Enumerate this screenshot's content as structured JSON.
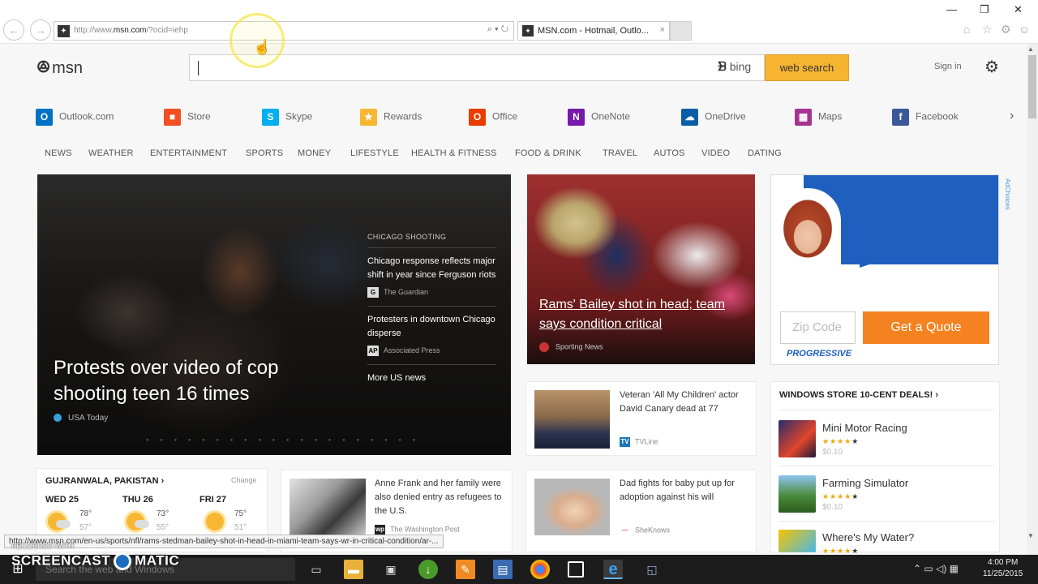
{
  "browser": {
    "url_prefix": "http://www.",
    "url_domain": "msn.com",
    "url_suffix": "/?ocid=iehp",
    "address_tools": "⌕ ▾ ↻",
    "tab_title": "MSN.com - Hotmail, Outlo...",
    "tab_close": "×",
    "back": "←",
    "forward": "→",
    "status_url": "http://www.msn.com/en-us/sports/nfl/rams-stedman-bailey-shot-in-head-in-miami-team-says-wr-in-critical-condition/ar-..."
  },
  "header": {
    "logo": "msn",
    "bing_label": "bing",
    "search_button": "web search",
    "signin": "Sign in"
  },
  "quick_links": [
    {
      "label": "Outlook.com",
      "icon": "outlook-icon",
      "color": "#0072c6",
      "glyph": "O"
    },
    {
      "label": "Store",
      "icon": "store-icon",
      "color": "#f25022",
      "glyph": "■"
    },
    {
      "label": "Skype",
      "icon": "skype-icon",
      "color": "#00aff0",
      "glyph": "S"
    },
    {
      "label": "Rewards",
      "icon": "rewards-icon",
      "color": "#f7b733",
      "glyph": "★"
    },
    {
      "label": "Office",
      "icon": "office-icon",
      "color": "#eb3c00",
      "glyph": "O"
    },
    {
      "label": "OneNote",
      "icon": "onenote-icon",
      "color": "#7719aa",
      "glyph": "N"
    },
    {
      "label": "OneDrive",
      "icon": "onedrive-icon",
      "color": "#0a5ea8",
      "glyph": "☁"
    },
    {
      "label": "Maps",
      "icon": "maps-icon",
      "color": "#a4348f",
      "glyph": "▦"
    },
    {
      "label": "Facebook",
      "icon": "facebook-icon",
      "color": "#3b5998",
      "glyph": "f"
    }
  ],
  "categories": [
    "NEWS",
    "WEATHER",
    "ENTERTAINMENT",
    "SPORTS",
    "MONEY",
    "LIFESTYLE",
    "HEALTH & FITNESS",
    "FOOD & DRINK",
    "TRAVEL",
    "AUTOS",
    "VIDEO",
    "DATING"
  ],
  "hero": {
    "title": "Protests over video of cop shooting teen 16 times",
    "source": "USA Today",
    "side_heading": "CHICAGO SHOOTING",
    "side_items": [
      {
        "title": "Chicago response reflects major shift in year since Ferguson riots",
        "source": "The Guardian",
        "logo": "G"
      },
      {
        "title": "Protesters in downtown Chicago disperse",
        "source": "Associated Press",
        "logo": "AP"
      }
    ],
    "more": "More US news"
  },
  "rams": {
    "title": "Rams' Bailey shot in head; team says condition critical",
    "source": "Sporting News"
  },
  "ad": {
    "zip_placeholder": "Zip Code",
    "cta": "Get a Quote",
    "brand": "PROGRESSIVE",
    "adchoices": "AdChoices",
    "colors": {
      "blue": "#1f5fbf",
      "orange": "#f58220"
    }
  },
  "news_cards": [
    {
      "text": "Veteran 'All My Children' actor David Canary dead at 77",
      "source": "TVLine",
      "logo": "TV",
      "logo_color": "#1b75bb"
    },
    {
      "text": "Anne Frank and her family were also denied entry as refugees to the U.S.",
      "source": "The Washington Post",
      "logo": "wp",
      "logo_color": "#222"
    },
    {
      "text": "Dad fights for baby put up for adoption against his will",
      "source": "SheKnows",
      "logo": "—",
      "logo_color": "#e55"
    }
  ],
  "store": {
    "heading": "WINDOWS STORE 10-CENT DEALS!",
    "apps": [
      {
        "name": "Mini Motor Racing",
        "stars": "★★★★",
        "empty": "★",
        "price": "$0.10"
      },
      {
        "name": "Farming Simulator",
        "stars": "★★★★",
        "empty": "★",
        "price": "$0.10"
      },
      {
        "name": "Where's My Water?",
        "stars": "★★★★",
        "empty": "★",
        "price": ""
      }
    ]
  },
  "weather": {
    "location": "GUJRANWALA, PAKISTAN",
    "change": "Change",
    "days": [
      {
        "day": "WED 25",
        "hi": "78°",
        "lo": "57°"
      },
      {
        "day": "THU 26",
        "hi": "73°",
        "lo": "55°"
      },
      {
        "day": "FRI 27",
        "hi": "75°",
        "lo": "51°"
      }
    ]
  },
  "overlay": {
    "recorded_with": "RECORDED WITH",
    "brand_left": "SCREENCAST",
    "brand_right": "MATIC"
  },
  "taskbar": {
    "search_placeholder": "Search the web and Windows",
    "time": "4:00 PM",
    "date": "11/25/2015"
  }
}
